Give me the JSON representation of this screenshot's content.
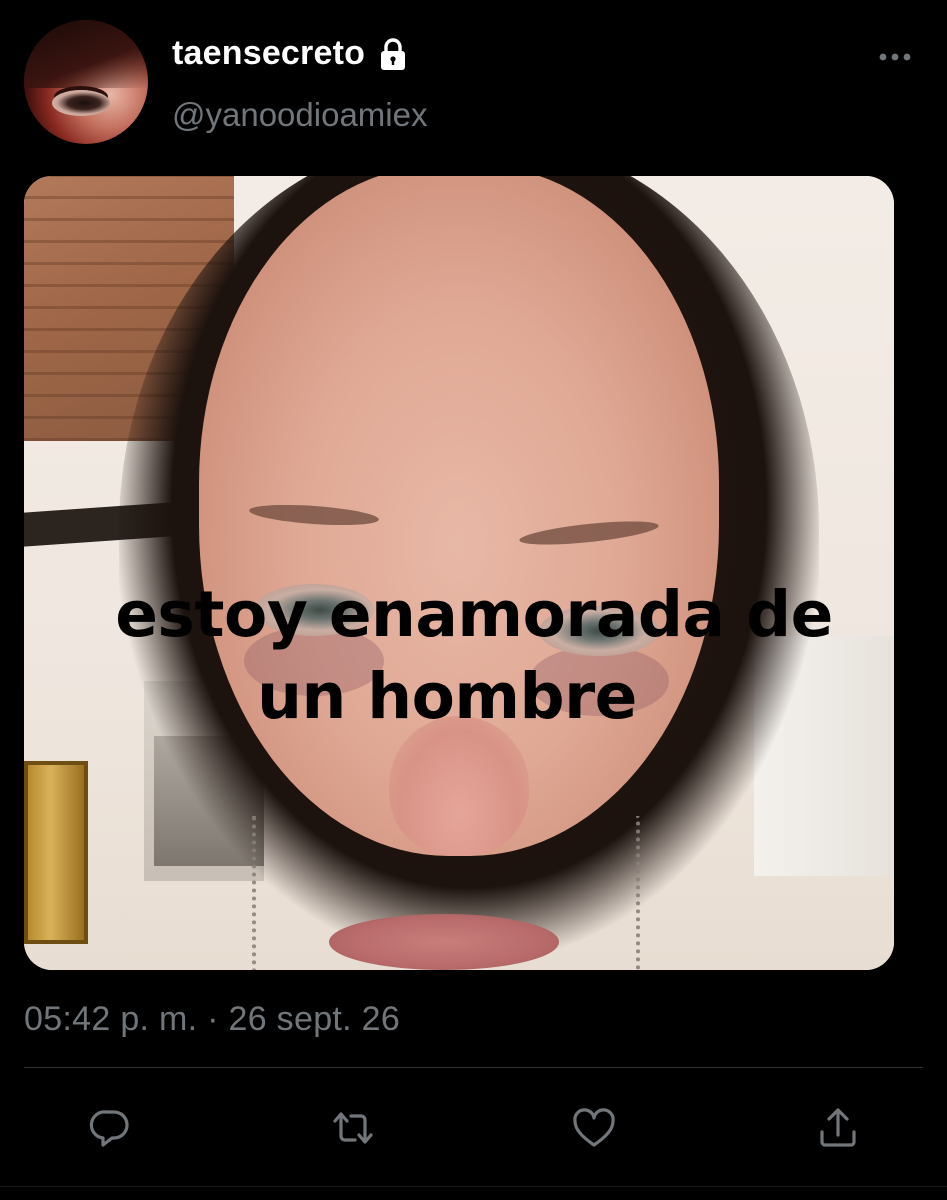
{
  "header": {
    "display_name": "taensecreto",
    "handle": "@yanoodioamiex",
    "protected_icon": "lock-icon",
    "more_icon": "more-horizontal-icon"
  },
  "media": {
    "caption_line1": "estoy enamorada de",
    "caption_line2": "un hombre"
  },
  "meta": {
    "timestamp": "05:42 p. m. · 26 sept. 26"
  },
  "actions": {
    "reply_icon": "reply-icon",
    "retweet_icon": "retweet-icon",
    "like_icon": "heart-icon",
    "share_icon": "share-icon"
  },
  "colors": {
    "background": "#000000",
    "primary_text": "#ffffff",
    "secondary_text": "#71767b",
    "divider": "#2f3336",
    "icon": "#71767b"
  }
}
